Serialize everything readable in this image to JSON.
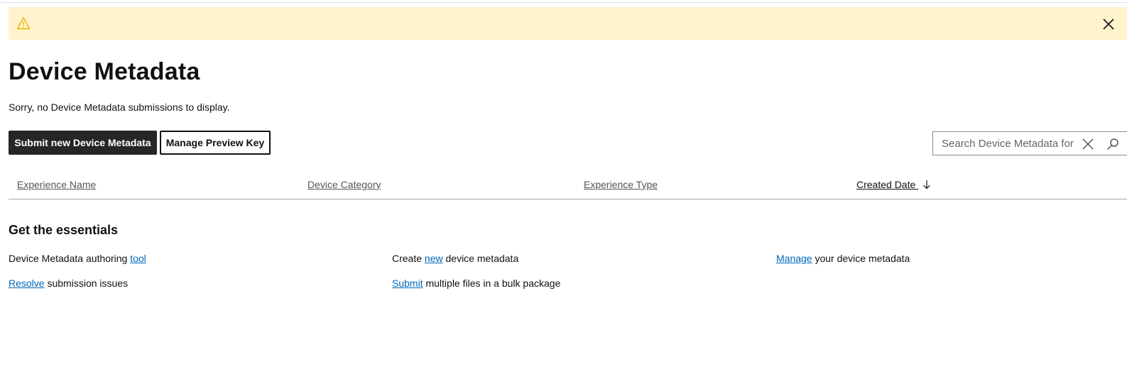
{
  "banner": {
    "icon": "warning-icon",
    "close_icon": "close-icon",
    "accent_color": "#fff4ce",
    "icon_color": "#f2b100"
  },
  "page": {
    "title": "Device Metadata",
    "empty_message": "Sorry, no Device Metadata submissions to display."
  },
  "toolbar": {
    "submit_label": "Submit new Device Metadata",
    "preview_key_label": "Manage Preview Key"
  },
  "search": {
    "placeholder": "Search Device Metadata for",
    "value": "",
    "clear_icon": "close-icon",
    "submit_icon": "search-icon"
  },
  "table": {
    "columns": [
      {
        "label": "Experience Name"
      },
      {
        "label": "Device Category"
      },
      {
        "label": "Experience Type"
      },
      {
        "label": "Created Date",
        "sort": "descending"
      }
    ],
    "rows": []
  },
  "essentials": {
    "title": "Get the essentials",
    "items": [
      {
        "before": "Device Metadata authoring ",
        "link": "tool",
        "after": ""
      },
      {
        "before": "Create ",
        "link": "new",
        "after": " device metadata"
      },
      {
        "before": "",
        "link": "Manage",
        "after": " your device metadata"
      },
      {
        "before": "",
        "link": "Resolve",
        "after": " submission issues"
      },
      {
        "before": "",
        "link": "Submit",
        "after": " multiple files in a bulk package"
      }
    ]
  }
}
